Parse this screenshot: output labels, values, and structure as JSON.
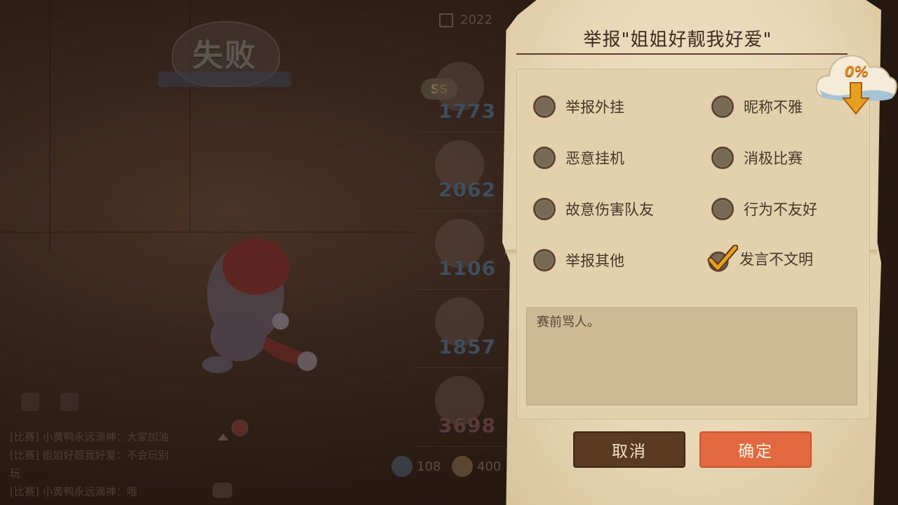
{
  "background": {
    "result_title": "失败",
    "date_text": "2022",
    "rank_scores": [
      "1773",
      "2062",
      "1106",
      "1857",
      "3698"
    ],
    "rank_badge": "SS",
    "chat_log": [
      "[比赛] 小黄鸭永远滴神：大家加油",
      "[比赛] 姐姐好靓我好爱：不会玩别",
      "玩",
      "[比赛] 小黄鸭永远滴神：哦"
    ],
    "currency_1": "108",
    "currency_2": "400"
  },
  "dialog": {
    "title": "举报\"姐姐好靓我好爱\"",
    "options": [
      {
        "label": "举报外挂",
        "checked": false
      },
      {
        "label": "昵称不雅",
        "checked": false
      },
      {
        "label": "恶意挂机",
        "checked": false
      },
      {
        "label": "消极比赛",
        "checked": false
      },
      {
        "label": "故意伤害队友",
        "checked": false
      },
      {
        "label": "行为不友好",
        "checked": false
      },
      {
        "label": "举报其他",
        "checked": false
      },
      {
        "label": "发言不文明",
        "checked": true
      }
    ],
    "reason_text": "赛前骂人。",
    "cancel_label": "取消",
    "confirm_label": "确定"
  },
  "download_badge": {
    "percent_text": "0%"
  },
  "colors": {
    "accent": "#e2683f",
    "cancel": "#5a3b22",
    "check": "#e8a01f"
  }
}
